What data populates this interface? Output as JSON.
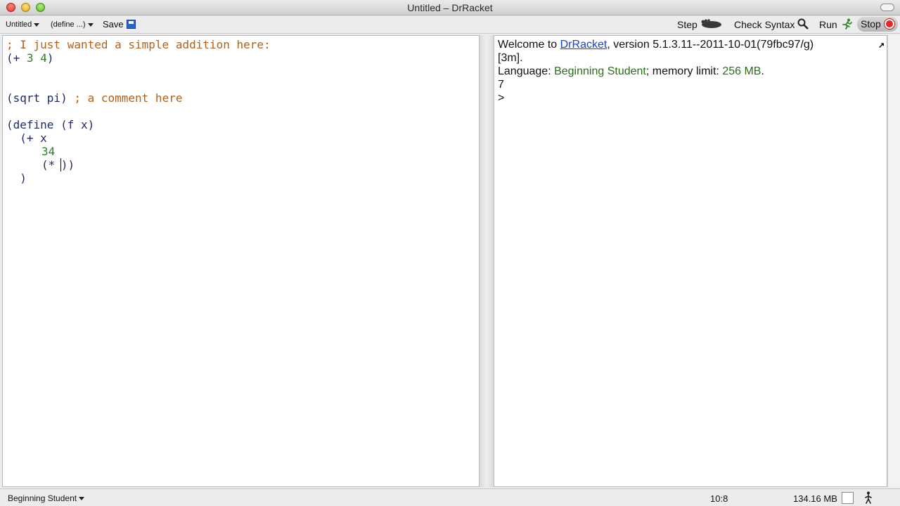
{
  "window": {
    "title": "Untitled – DrRacket"
  },
  "toolbar": {
    "tab_name": "Untitled",
    "define_menu": "(define ...)",
    "save_label": "Save",
    "step_label": "Step",
    "check_syntax_label": "Check Syntax",
    "run_label": "Run",
    "stop_label": "Stop",
    "icons": [
      "save-icon",
      "step-foot-icon",
      "magnifier-icon",
      "runner-icon",
      "stop-icon"
    ]
  },
  "definitions": {
    "line1": "; I just wanted a simple addition here:",
    "line2": "(+ 3 4)",
    "line5_code": "(sqrt pi)",
    "line5_comment": " ; a comment here",
    "line7": "(define (f x)",
    "line8": "  (+ x",
    "line9": "34",
    "line10_a": "(* ",
    "line10_b": "))",
    "line11": "  )"
  },
  "interactions": {
    "welcome_prefix": "Welcome to ",
    "drracket_link": "DrRacket",
    "welcome_suffix": ", version 5.1.3.11--2011-10-01(79fbc97/g)",
    "build_tag": "[3m].",
    "language_label": "Language: ",
    "language_name": "Beginning Student",
    "memory_text": "; memory limit: ",
    "memory_value": "256 MB",
    "memory_end": ".",
    "result": "7",
    "prompt": ">"
  },
  "statusbar": {
    "language": "Beginning Student",
    "cursor_position": "10:8",
    "memory": "134.16 MB"
  },
  "colors": {
    "comment": "#b0611b",
    "paren": "#1f2b66",
    "constant": "#2e7d32",
    "link": "#1c3fc4",
    "stop": "#e8262a"
  }
}
